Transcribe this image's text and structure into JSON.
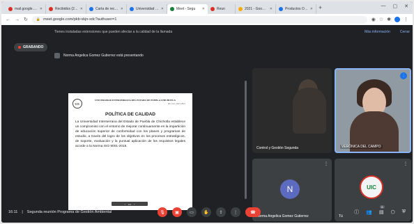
{
  "browser": {
    "tabs": [
      {
        "label": "mail.google.com",
        "active": false,
        "color": "red"
      },
      {
        "label": "Recibidos (28) - G",
        "active": false,
        "color": "red"
      },
      {
        "label": "Carta de recomen",
        "active": false,
        "color": "blue"
      },
      {
        "label": "Universidad Inter",
        "active": false,
        "color": "blue"
      },
      {
        "label": "Meet - Segu",
        "active": true,
        "color": "green"
      },
      {
        "label": "Reun",
        "active": false,
        "color": "red"
      },
      {
        "label": "2021 - Google D",
        "active": false,
        "color": "yellow"
      },
      {
        "label": "Productos Orico",
        "active": false,
        "color": "blue"
      }
    ],
    "url": "meet.google.com/pkb-vkjn-xdc?authuser=1"
  },
  "meet": {
    "banner_text": "Tienes instaladas extensiones que pueden afectar a la calidad de la llamada",
    "banner_link1": "Más información",
    "banner_link2": "Cerrar",
    "recording_label": "GRABANDO",
    "presenting_text": "Norma Angelica Gomez Gutierrez está presentando",
    "slide": {
      "logo_text": "UIC",
      "university": "UNIVERSIDAD INTERSERRANA DEL ESTADO DE PUEBLA CHICHOTLA",
      "ref": "RC-14.1/ 2015-2021",
      "title": "POLÍTICA DE CALIDAD",
      "body": "La Universidad Interserrana del Estado de Puebla de Chichotla establece un compromiso con el entorno de mejorar continuamente en la impartición de educación superior de conformidad con los planes y programas de estudio, a través del logro de los objetivos en los procesos estratégicos, de soporte, evaluación y la puntual aplicación de los requisitos legales acorde a la Norma ISO 9001-2015."
    },
    "participants": [
      {
        "name": "Control y Gestión Segunda"
      },
      {
        "name": "VERÓNICA DEL CAMPO"
      },
      {
        "name": "Norma Angelica Gomez Gutierrez",
        "initial": "N"
      },
      {
        "name": "Tú",
        "logo": "UIC"
      }
    ],
    "time": "16:11",
    "meeting_title": "Segunda reunión Programa de Gestión Ambiental",
    "participant_count": "6"
  }
}
